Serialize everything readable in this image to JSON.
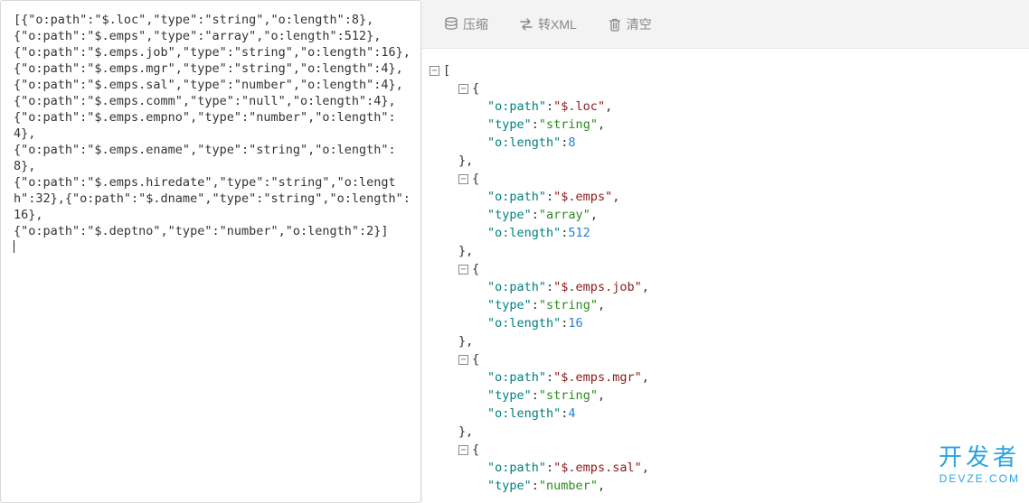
{
  "toolbar": {
    "compress_label": "压缩",
    "toxml_label": "转XML",
    "clear_label": "清空"
  },
  "raw_input": "[{\"o:path\":\"$.loc\",\"type\":\"string\",\"o:length\":8},\n{\"o:path\":\"$.emps\",\"type\":\"array\",\"o:length\":512},\n{\"o:path\":\"$.emps.job\",\"type\":\"string\",\"o:length\":16},\n{\"o:path\":\"$.emps.mgr\",\"type\":\"string\",\"o:length\":4},\n{\"o:path\":\"$.emps.sal\",\"type\":\"number\",\"o:length\":4},\n{\"o:path\":\"$.emps.comm\",\"type\":\"null\",\"o:length\":4},\n{\"o:path\":\"$.emps.empno\",\"type\":\"number\",\"o:length\":4},\n{\"o:path\":\"$.emps.ename\",\"type\":\"string\",\"o:length\":8},\n{\"o:path\":\"$.emps.hiredate\",\"type\":\"string\",\"o:length\":32},{\"o:path\":\"$.dname\",\"type\":\"string\",\"o:length\":16},\n{\"o:path\":\"$.deptno\",\"type\":\"number\",\"o:length\":2}]",
  "tree_items": [
    {
      "o:path": "$.loc",
      "type": "string",
      "o:length": 8
    },
    {
      "o:path": "$.emps",
      "type": "array",
      "o:length": 512
    },
    {
      "o:path": "$.emps.job",
      "type": "string",
      "o:length": 16
    },
    {
      "o:path": "$.emps.mgr",
      "type": "string",
      "o:length": 4
    },
    {
      "o:path": "$.emps.sal",
      "type": "number",
      "o:length": null
    }
  ],
  "key_labels": {
    "path": "o:path",
    "type": "type",
    "length": "o:length"
  },
  "tree_open_bracket": "[",
  "watermark": {
    "line1": "开发者",
    "line2": "DEVZE.COM"
  }
}
